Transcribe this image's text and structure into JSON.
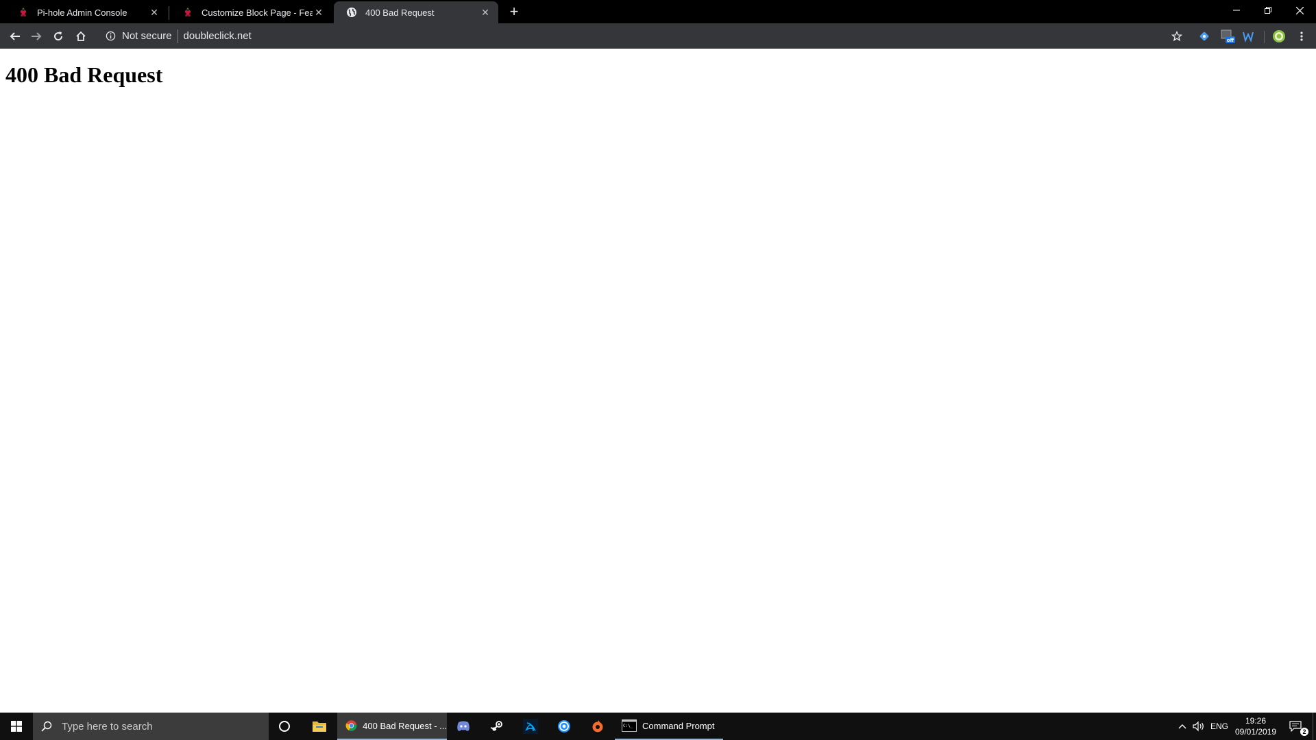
{
  "browser": {
    "tabs": [
      {
        "title": "Pi-hole Admin Console",
        "favicon": "raspberry-icon",
        "active": false
      },
      {
        "title": "Customize Block Page - Feature",
        "favicon": "raspberry-icon",
        "active": false
      },
      {
        "title": "400 Bad Request",
        "favicon": "globe-icon",
        "active": true
      }
    ],
    "omnibox": {
      "security_label": "Not secure",
      "url": "doubleclick.net"
    },
    "extensions": [
      "extension-puzzle-icon",
      "off-extension-icon",
      "w-extension-icon",
      "profile-avatar-icon"
    ]
  },
  "page": {
    "heading": "400 Bad Request"
  },
  "taskbar": {
    "search_placeholder": "Type here to search",
    "apps": [
      {
        "name": "cortana",
        "icon": "cortana-icon"
      },
      {
        "name": "file-explorer",
        "icon": "folder-icon"
      },
      {
        "name": "chrome",
        "icon": "chrome-icon",
        "label": "400 Bad Request - ..."
      },
      {
        "name": "discord",
        "icon": "discord-icon"
      },
      {
        "name": "steam",
        "icon": "steam-icon"
      },
      {
        "name": "battlenet",
        "icon": "battlenet-icon"
      },
      {
        "name": "uplay",
        "icon": "uplay-icon"
      },
      {
        "name": "origin",
        "icon": "origin-icon"
      },
      {
        "name": "command-prompt",
        "icon": "cmd-icon",
        "label": "Command Prompt"
      }
    ],
    "tray": {
      "language": "ENG",
      "time": "19:26",
      "date": "09/01/2019",
      "notification_count": "2"
    }
  },
  "colors": {
    "tabstrip": "#000000",
    "toolbar": "#35363a",
    "taskbar": "#101010",
    "search_box": "#3c3c3c",
    "accent_blue": "#1a73e8"
  }
}
